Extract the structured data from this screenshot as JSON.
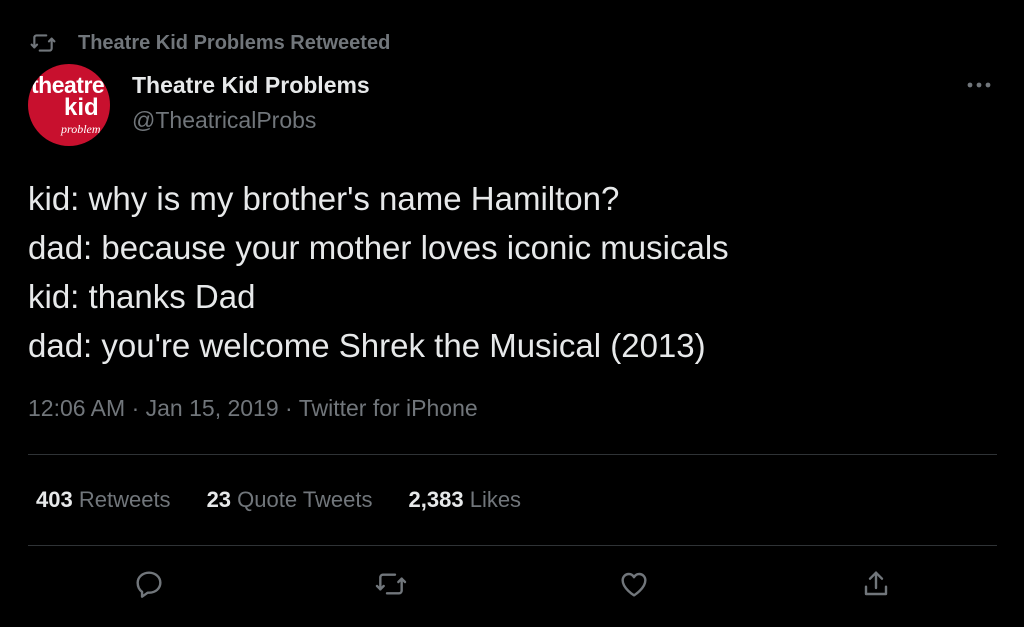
{
  "retweet_banner": {
    "text": "Theatre Kid Problems Retweeted",
    "icon": "retweet-icon"
  },
  "author": {
    "display_name": "Theatre Kid Problems",
    "handle": "@TheatricalProbs",
    "avatar": {
      "logo_lines": [
        "theatre",
        "kid",
        "problem"
      ],
      "background": "#c8102e"
    }
  },
  "more_icon": "more-horizontal-icon",
  "tweet": {
    "lines": [
      "kid: why is my brother's name Hamilton?",
      "dad: because your mother loves iconic musicals",
      "kid: thanks Dad",
      "dad: you're welcome Shrek the Musical (2013)"
    ],
    "time": "12:06 AM",
    "separator": "·",
    "date": "Jan 15, 2019",
    "source": "Twitter for iPhone"
  },
  "stats": {
    "retweets": {
      "value": "403",
      "label": "Retweets"
    },
    "quote_tweets": {
      "value": "23",
      "label": "Quote Tweets"
    },
    "likes": {
      "value": "2,383",
      "label": "Likes"
    }
  },
  "actions": {
    "reply_icon": "reply-icon",
    "retweet_icon": "retweet-icon",
    "like_icon": "heart-icon",
    "share_icon": "share-icon"
  },
  "colors": {
    "background": "#000000",
    "primary_text": "#e7e9ea",
    "secondary_text": "#71767b",
    "divider": "#2f3336"
  }
}
